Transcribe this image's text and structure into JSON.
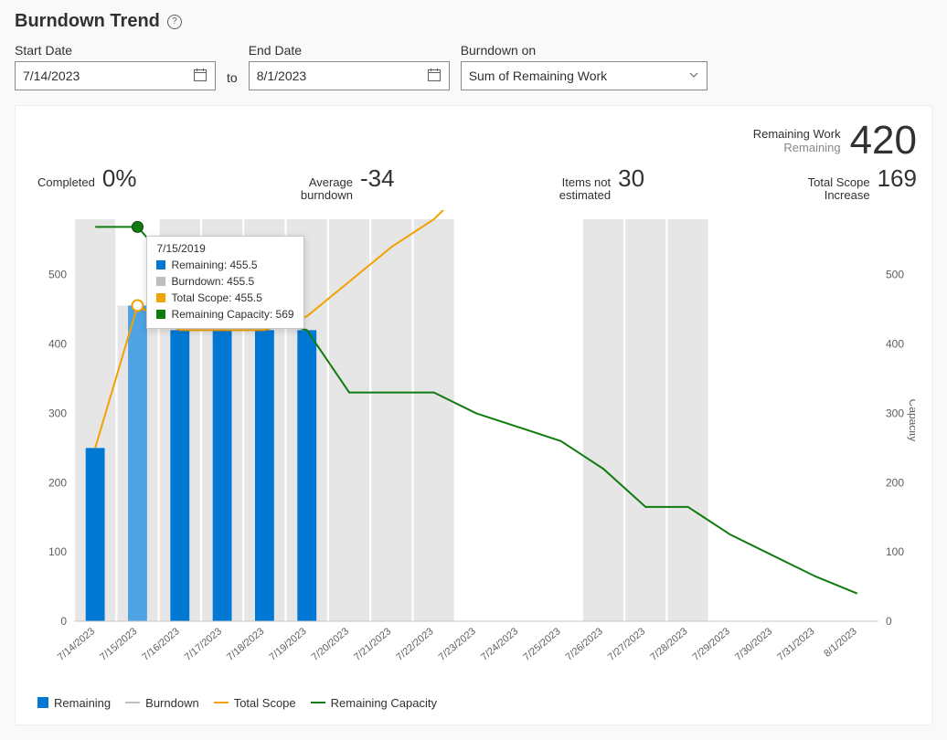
{
  "title": "Burndown Trend",
  "filters": {
    "start_date": {
      "label": "Start Date",
      "value": "7/14/2023"
    },
    "to_label": "to",
    "end_date": {
      "label": "End Date",
      "value": "8/1/2023"
    },
    "burndown_on": {
      "label": "Burndown on",
      "value": "Sum of Remaining Work"
    }
  },
  "summary": {
    "remaining_work_label1": "Remaining Work",
    "remaining_work_label2": "Remaining",
    "remaining_work_value": "420",
    "completed_label": "Completed",
    "completed_value": "0%",
    "avg_burndown_label": "Average burndown",
    "avg_burndown_value": "-34",
    "items_not_estimated_label": "Items not estimated",
    "items_not_estimated_value": "30",
    "total_scope_increase_label": "Total Scope Increase",
    "total_scope_increase_value": "169"
  },
  "chart_data": {
    "type": "bar",
    "categories": [
      "7/14/2023",
      "7/15/2023",
      "7/16/2023",
      "7/17/2023",
      "7/18/2023",
      "7/19/2023",
      "7/20/2023",
      "7/21/2023",
      "7/22/2023",
      "7/23/2023",
      "7/24/2023",
      "7/25/2023",
      "7/26/2023",
      "7/27/2023",
      "7/28/2023",
      "7/29/2023",
      "7/30/2023",
      "7/31/2023",
      "8/1/2023"
    ],
    "series": [
      {
        "name": "Remaining",
        "type": "bar",
        "color": "#0078D4",
        "values": [
          250,
          455.5,
          420,
          420,
          420,
          420,
          null,
          null,
          null,
          null,
          null,
          null,
          null,
          null,
          null,
          null,
          null,
          null,
          null
        ]
      },
      {
        "name": "Burndown",
        "type": "bar",
        "color": "#BEBEBE",
        "values": [
          580,
          455.5,
          580,
          580,
          580,
          580,
          580,
          580,
          580,
          null,
          null,
          null,
          580,
          580,
          580,
          null,
          null,
          null,
          null
        ]
      },
      {
        "name": "Total Scope",
        "type": "line",
        "color": "#F2A100",
        "values": [
          250,
          455.5,
          420,
          420,
          420,
          440,
          490,
          540,
          580,
          640,
          null,
          null,
          null,
          null,
          null,
          null,
          null,
          null,
          null
        ]
      },
      {
        "name": "Remaining Capacity",
        "type": "line",
        "color": "#107C10",
        "values": [
          569,
          569,
          500,
          460,
          440,
          420,
          330,
          330,
          330,
          300,
          280,
          260,
          220,
          165,
          165,
          125,
          95,
          65,
          40
        ]
      }
    ],
    "ylim_left": [
      0,
      580
    ],
    "y_ticks_left": [
      0,
      100,
      200,
      300,
      400,
      500
    ],
    "ylim_right": [
      0,
      580
    ],
    "y_ticks_right": [
      0,
      100,
      200,
      300,
      400,
      500
    ],
    "xlabel": "",
    "ylabel_left": "",
    "ylabel_right": "Capacity",
    "highlight_index": 1,
    "tooltip": {
      "title": "7/15/2019",
      "rows": [
        {
          "color": "#0078D4",
          "label": "Remaining: 455.5"
        },
        {
          "color": "#BEBEBE",
          "label": "Burndown: 455.5"
        },
        {
          "color": "#F2A100",
          "label": "Total Scope: 455.5"
        },
        {
          "color": "#107C10",
          "label": "Remaining Capacity: 569"
        }
      ]
    },
    "legend": [
      {
        "name": "Remaining",
        "color": "#0078D4",
        "shape": "square"
      },
      {
        "name": "Burndown",
        "color": "#BEBEBE",
        "shape": "line"
      },
      {
        "name": "Total Scope",
        "color": "#F2A100",
        "shape": "line"
      },
      {
        "name": "Remaining Capacity",
        "color": "#107C10",
        "shape": "line"
      }
    ]
  }
}
